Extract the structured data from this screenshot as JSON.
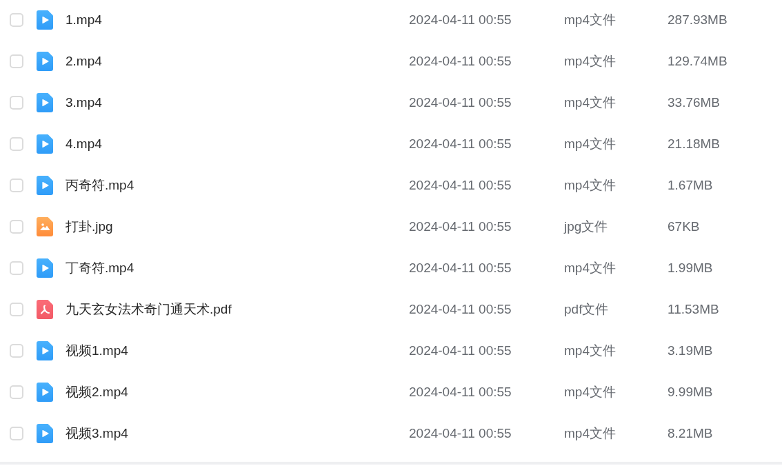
{
  "files": [
    {
      "checked": false,
      "kind": "video",
      "name": "1.mp4",
      "modified": "2024-04-11 00:55",
      "type": "mp4文件",
      "size": "287.93MB"
    },
    {
      "checked": false,
      "kind": "video",
      "name": "2.mp4",
      "modified": "2024-04-11 00:55",
      "type": "mp4文件",
      "size": "129.74MB"
    },
    {
      "checked": false,
      "kind": "video",
      "name": "3.mp4",
      "modified": "2024-04-11 00:55",
      "type": "mp4文件",
      "size": "33.76MB"
    },
    {
      "checked": false,
      "kind": "video",
      "name": "4.mp4",
      "modified": "2024-04-11 00:55",
      "type": "mp4文件",
      "size": "21.18MB"
    },
    {
      "checked": false,
      "kind": "video",
      "name": "丙奇符.mp4",
      "modified": "2024-04-11 00:55",
      "type": "mp4文件",
      "size": "1.67MB"
    },
    {
      "checked": false,
      "kind": "image",
      "name": "打卦.jpg",
      "modified": "2024-04-11 00:55",
      "type": "jpg文件",
      "size": "67KB"
    },
    {
      "checked": false,
      "kind": "video",
      "name": "丁奇符.mp4",
      "modified": "2024-04-11 00:55",
      "type": "mp4文件",
      "size": "1.99MB"
    },
    {
      "checked": false,
      "kind": "pdf",
      "name": "九天玄女法术奇门通天术.pdf",
      "modified": "2024-04-11 00:55",
      "type": "pdf文件",
      "size": "11.53MB"
    },
    {
      "checked": false,
      "kind": "video",
      "name": "视频1.mp4",
      "modified": "2024-04-11 00:55",
      "type": "mp4文件",
      "size": "3.19MB"
    },
    {
      "checked": false,
      "kind": "video",
      "name": "视频2.mp4",
      "modified": "2024-04-11 00:55",
      "type": "mp4文件",
      "size": "9.99MB"
    },
    {
      "checked": false,
      "kind": "video",
      "name": "视频3.mp4",
      "modified": "2024-04-11 00:55",
      "type": "mp4文件",
      "size": "8.21MB"
    }
  ]
}
